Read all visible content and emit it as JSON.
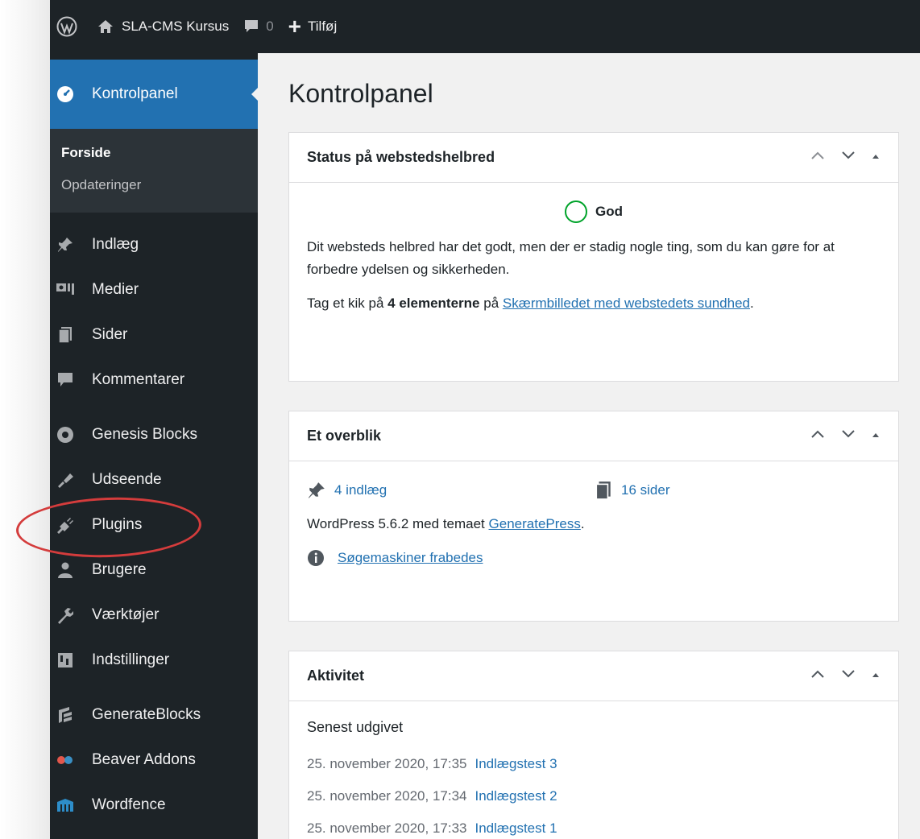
{
  "adminbar": {
    "site_name": "SLA-CMS Kursus",
    "comments_count": "0",
    "new_label": "Tilføj"
  },
  "sidebar": {
    "active": {
      "label": "Kontrolpanel",
      "icon": "dashboard-icon"
    },
    "submenu": [
      {
        "label": "Forside",
        "current": true
      },
      {
        "label": "Opdateringer",
        "current": false
      }
    ],
    "items": [
      {
        "label": "Indlæg",
        "icon": "pin-icon"
      },
      {
        "label": "Medier",
        "icon": "media-icon"
      },
      {
        "label": "Sider",
        "icon": "pages-icon"
      },
      {
        "label": "Kommentarer",
        "icon": "comments-icon"
      },
      {
        "label": "Genesis Blocks",
        "icon": "genesis-icon"
      },
      {
        "label": "Udseende",
        "icon": "appearance-icon"
      },
      {
        "label": "Plugins",
        "icon": "plugins-icon"
      },
      {
        "label": "Brugere",
        "icon": "users-icon"
      },
      {
        "label": "Værktøjer",
        "icon": "tools-icon"
      },
      {
        "label": "Indstillinger",
        "icon": "settings-icon"
      },
      {
        "label": "GenerateBlocks",
        "icon": "generateblocks-icon"
      },
      {
        "label": "Beaver Addons",
        "icon": "beaver-icon"
      },
      {
        "label": "Wordfence",
        "icon": "wordfence-icon"
      }
    ],
    "highlight_color": "#d43c3c"
  },
  "main": {
    "title": "Kontrolpanel",
    "health": {
      "title": "Status på webstedshelbred",
      "status": "God",
      "text": "Dit websteds helbred har det godt, men der er stadig nogle ting, som du kan gøre for at forbedre ydelsen og sikkerheden.",
      "items_prefix": "Tag et kik på ",
      "items_bold": "4 elementerne",
      "items_mid": " på ",
      "items_link": "Skærmbilledet med webstedets sundhed",
      "items_suffix": "."
    },
    "glance": {
      "title": "Et overblik",
      "posts": "4 indlæg",
      "pages": "16 sider",
      "version_prefix": "WordPress 5.6.2 med temaet ",
      "theme": "GeneratePress",
      "version_suffix": ".",
      "search_engines": "Søgemaskiner frabedes"
    },
    "activity": {
      "title": "Aktivitet",
      "subtitle": "Senest udgivet",
      "rows": [
        {
          "date": "25. november 2020, 17:35",
          "title": "Indlægstest 3"
        },
        {
          "date": "25. november 2020, 17:34",
          "title": "Indlægstest 2"
        },
        {
          "date": "25. november 2020, 17:33",
          "title": "Indlægstest 1"
        }
      ]
    }
  },
  "colors": {
    "adminbar": "#1d2327",
    "sidebar": "#1d2327",
    "accent": "#2271b1",
    "good": "#00a32a"
  }
}
